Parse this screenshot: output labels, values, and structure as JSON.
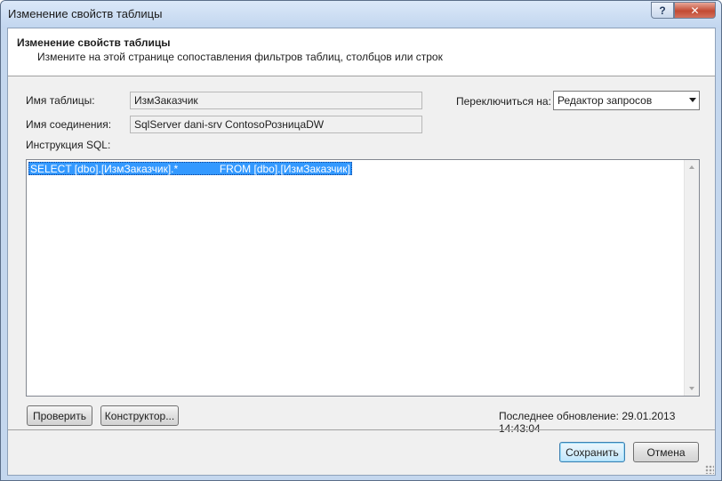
{
  "window": {
    "title": "Изменение свойств таблицы",
    "help_label": "?",
    "close_label": "✕"
  },
  "banner": {
    "title": "Изменение свойств таблицы",
    "description": "Измените на этой странице сопоставления фильтров таблиц, столбцов или строк"
  },
  "form": {
    "table_name_label": "Имя таблицы:",
    "table_name_value": "ИзмЗаказчик",
    "connection_label": "Имя соединения:",
    "connection_value": "SqlServer dani-srv ContosoРозницаDW",
    "switch_label": "Переключиться на:",
    "switch_value": "Редактор запросов",
    "sql_label": "Инструкция SQL:"
  },
  "editor": {
    "sql_text": "SELECT [dbo].[ИзмЗаказчик].*              FROM [dbo].[ИзмЗаказчик]"
  },
  "actions": {
    "validate_label": "Проверить",
    "designer_label": "Конструктор...",
    "last_updated": "Последнее обновление: 29.01.2013 14:43:04"
  },
  "footer": {
    "save_label": "Сохранить",
    "cancel_label": "Отмена"
  }
}
